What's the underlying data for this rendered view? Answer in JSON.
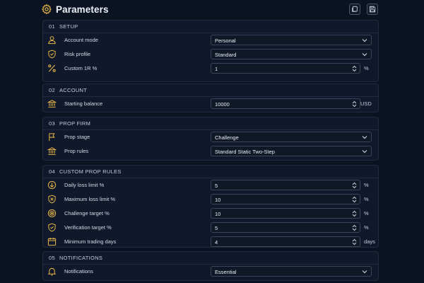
{
  "header": {
    "title": "Parameters",
    "gear_icon": "gear-icon",
    "copy_icon": "copy-icon",
    "save_icon": "save-icon"
  },
  "sections": {
    "setup": {
      "number": "01",
      "title": "SETUP",
      "account_mode": {
        "label": "Account mode",
        "value": "Personal",
        "icon": "user-icon"
      },
      "risk_profile": {
        "label": "Risk profile",
        "value": "Standard",
        "icon": "shield-icon"
      },
      "custom_1r": {
        "label": "Custom 1R %",
        "value": "1",
        "unit": "%",
        "icon": "percent-icon"
      }
    },
    "account": {
      "number": "02",
      "title": "ACCOUNT",
      "starting_balance": {
        "label": "Starting balance",
        "value": "10000",
        "unit": "USD",
        "icon": "bank-icon"
      }
    },
    "prop_firm": {
      "number": "03",
      "title": "PROP FIRM",
      "prop_stage": {
        "label": "Prop stage",
        "value": "Challenge",
        "icon": "flag-icon"
      },
      "prop_rules": {
        "label": "Prop rules",
        "value": "Standard Static Two-Step",
        "icon": "building-icon"
      }
    },
    "custom_prop_rules": {
      "number": "04",
      "title": "CUSTOM PROP RULES",
      "daily_loss": {
        "label": "Daily loss limit %",
        "value": "5",
        "unit": "%",
        "icon": "down-arrow-circle-icon"
      },
      "max_loss": {
        "label": "Maximum loss limit %",
        "value": "10",
        "unit": "%",
        "icon": "shield-x-icon"
      },
      "challenge_target": {
        "label": "Challenge target %",
        "value": "10",
        "unit": "%",
        "icon": "target-icon"
      },
      "verification_target": {
        "label": "Verification target %",
        "value": "5",
        "unit": "%",
        "icon": "shield-check-icon"
      },
      "min_days": {
        "label": "Minimum trading days",
        "value": "4",
        "unit": "days",
        "icon": "calendar-icon"
      }
    },
    "notifications": {
      "number": "05",
      "title": "NOTIFICATIONS",
      "notifications": {
        "label": "Notifications",
        "value": "Essential",
        "icon": "bell-icon"
      }
    }
  },
  "colors": {
    "accent": "#e5b448",
    "background": "#0b1322",
    "panel": "#0f192b",
    "field_border": "#39455a"
  }
}
